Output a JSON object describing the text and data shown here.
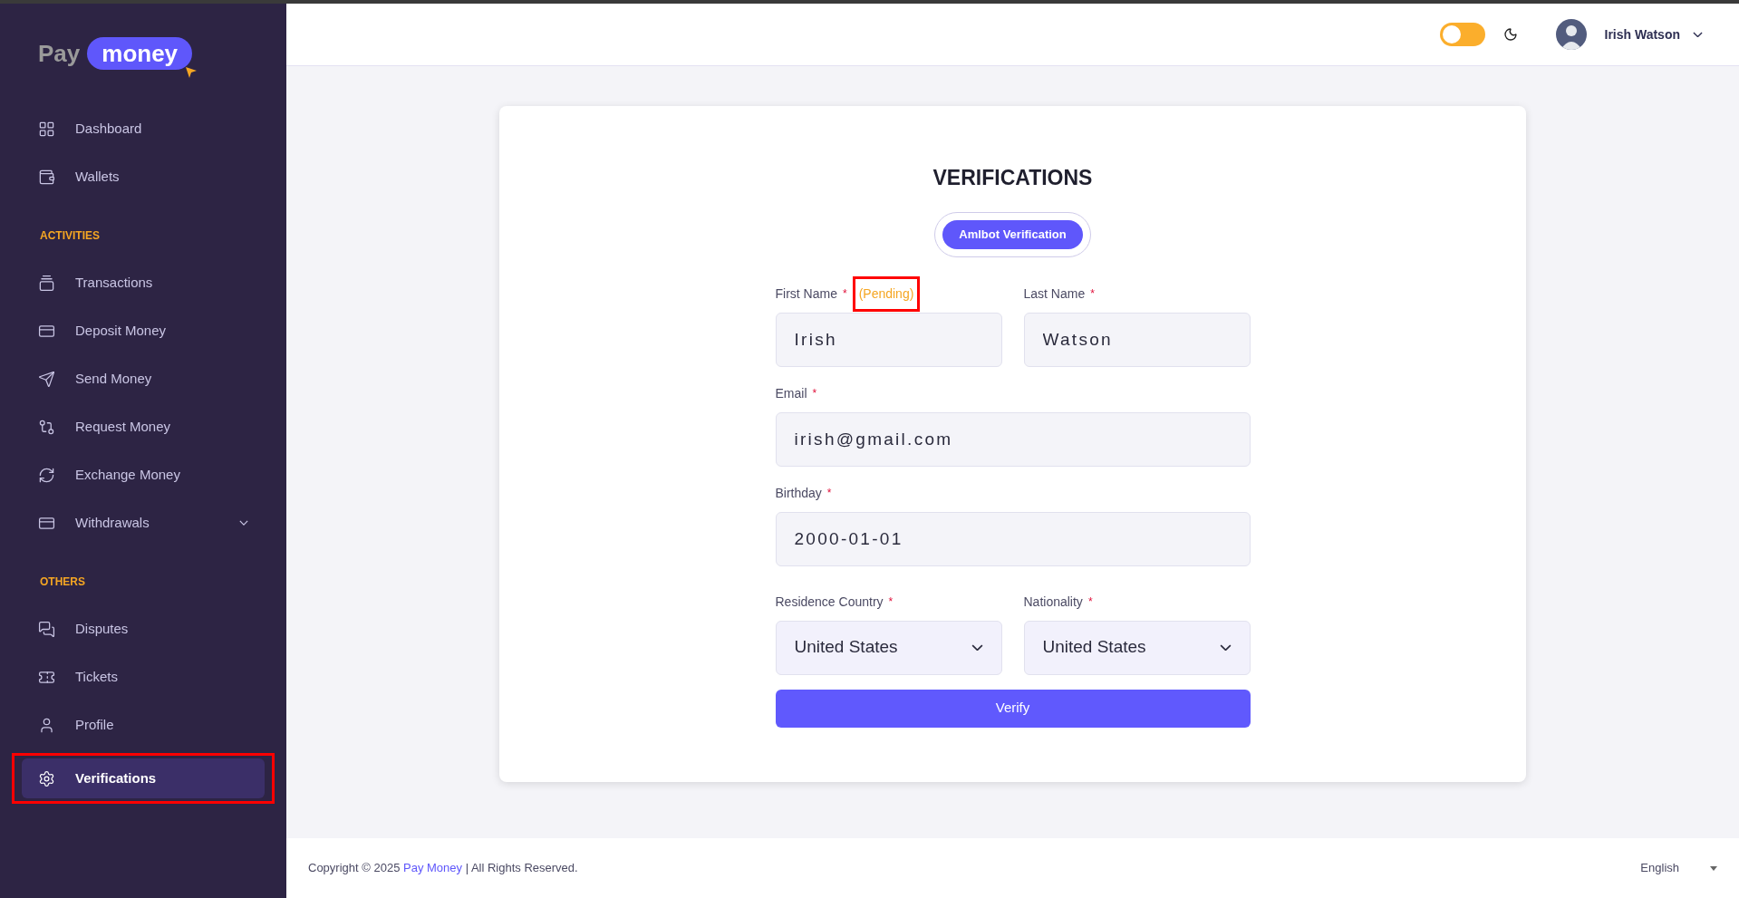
{
  "logo": {
    "word": "Pay",
    "pill": "money"
  },
  "sidebar": {
    "sections": [
      {
        "items": [
          {
            "label": "Dashboard",
            "selected": false,
            "expandable": false,
            "highlighted": false
          },
          {
            "label": "Wallets",
            "selected": false,
            "expandable": false,
            "highlighted": false
          }
        ]
      },
      {
        "heading": "ACTIVITIES",
        "items": [
          {
            "label": "Transactions",
            "selected": false,
            "expandable": false,
            "highlighted": false
          },
          {
            "label": "Deposit Money",
            "selected": false,
            "expandable": false,
            "highlighted": false
          },
          {
            "label": "Send Money",
            "selected": false,
            "expandable": false,
            "highlighted": false
          },
          {
            "label": "Request Money",
            "selected": false,
            "expandable": false,
            "highlighted": false
          },
          {
            "label": "Exchange Money",
            "selected": false,
            "expandable": false,
            "highlighted": false
          },
          {
            "label": "Withdrawals",
            "selected": false,
            "expandable": true,
            "highlighted": false
          }
        ]
      },
      {
        "heading": "OTHERS",
        "items": [
          {
            "label": "Disputes",
            "selected": false,
            "expandable": false,
            "highlighted": false
          },
          {
            "label": "Tickets",
            "selected": false,
            "expandable": false,
            "highlighted": false
          },
          {
            "label": "Profile",
            "selected": false,
            "expandable": false,
            "highlighted": false
          },
          {
            "label": "Verifications",
            "selected": true,
            "expandable": false,
            "highlighted": true
          }
        ]
      }
    ]
  },
  "header": {
    "dark_mode": false,
    "user_name": "Irish Watson"
  },
  "card": {
    "title": "VERIFICATIONS",
    "tabs": [
      {
        "label": "Amlbot Verification",
        "selected": true
      }
    ],
    "rows": [
      [
        {
          "kind": "text",
          "label": "First Name",
          "required_mark": "*",
          "status": "(Pending)",
          "status_highlighted": true,
          "value": "Irish"
        },
        {
          "kind": "text",
          "label": "Last Name",
          "required_mark": "*",
          "value": "Watson"
        }
      ],
      [
        {
          "kind": "text",
          "label": "Email",
          "required_mark": "*",
          "value": "irish@gmail.com"
        }
      ],
      [
        {
          "kind": "text",
          "label": "Birthday",
          "required_mark": "*",
          "value": "2000-01-01"
        }
      ],
      [
        {
          "kind": "select",
          "label": "Residence Country",
          "required_mark": "*",
          "value": "United States"
        },
        {
          "kind": "select",
          "label": "Nationality",
          "required_mark": "*",
          "value": "United States"
        }
      ]
    ],
    "submit": "Verify"
  },
  "footer": {
    "copyright_before": "Copyright © 2025 ",
    "brand_link": "Pay Money",
    "copyright_after": " | All Rights Reserved.",
    "language": "English"
  }
}
